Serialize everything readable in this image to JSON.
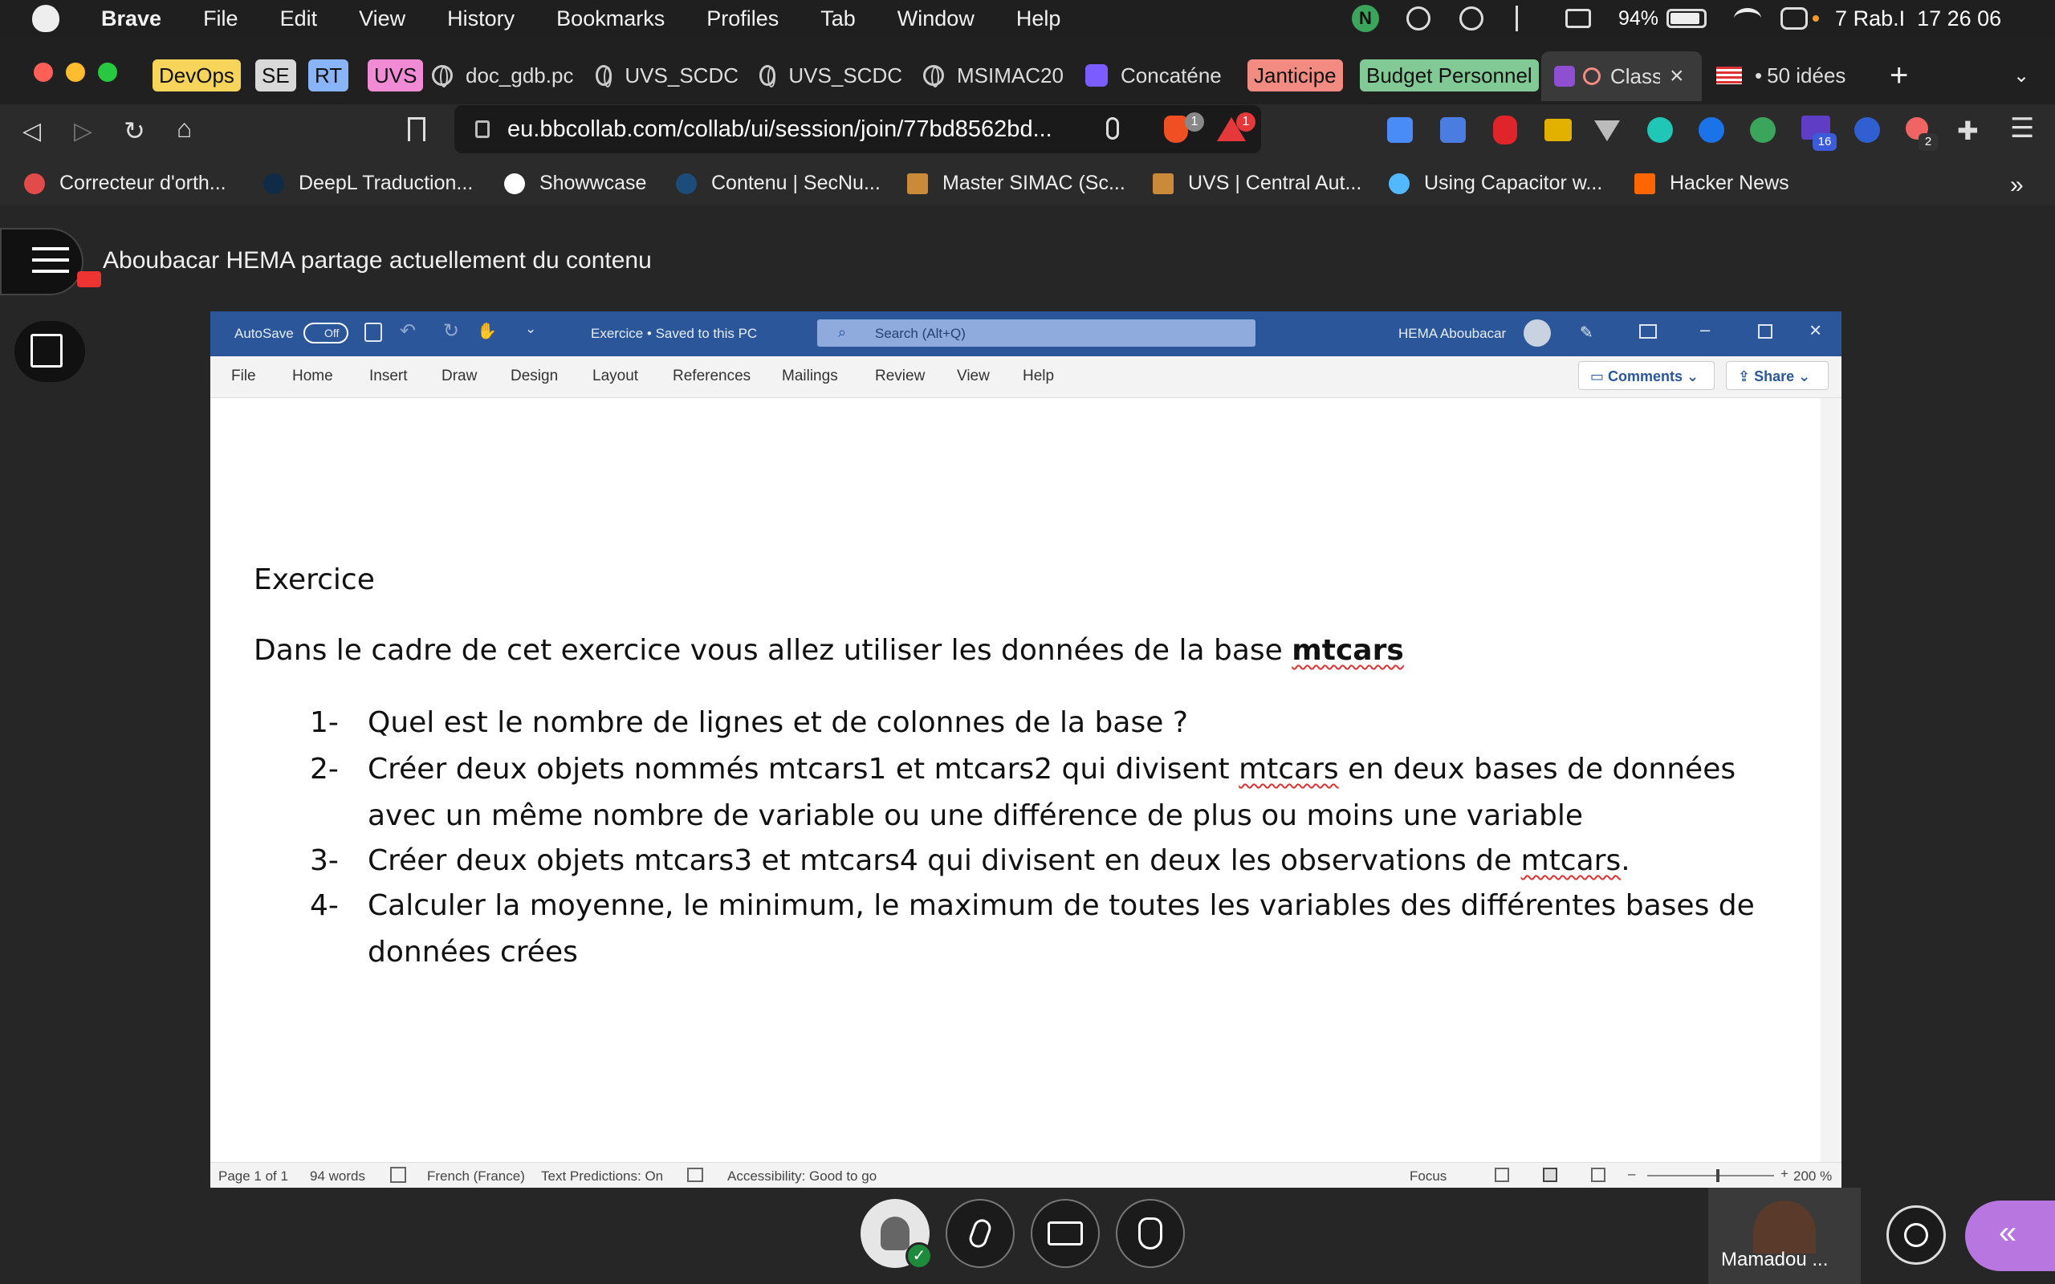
{
  "menubar": {
    "app": "Brave",
    "items": [
      "File",
      "Edit",
      "View",
      "History",
      "Bookmarks",
      "Profiles",
      "Tab",
      "Window",
      "Help"
    ],
    "battery": "94%",
    "datetime": "7 Rab.I  17 26 06"
  },
  "tabs": {
    "groups": [
      {
        "label": "DevOps",
        "color": "#f7d45a"
      },
      {
        "label": "SE",
        "color": "#d9d9d9"
      },
      {
        "label": "RT",
        "color": "#8ab4f8"
      },
      {
        "label": "UVS",
        "color": "#f28bd6"
      }
    ],
    "items": [
      {
        "label": "doc_gdb.pc"
      },
      {
        "label": "UVS_SCDC"
      },
      {
        "label": "UVS_SCDC"
      },
      {
        "label": "MSIMAC20"
      },
      {
        "label": "Concaténe"
      }
    ],
    "group_janticipe": {
      "label": "Janticipe",
      "color": "#f28b82"
    },
    "group_budget": {
      "label": "Budget Personnel",
      "color": "#81c995"
    },
    "active": {
      "label": "Class"
    },
    "last": {
      "label": "50 idées"
    }
  },
  "nav": {
    "url": "eu.bbcollab.com/collab/ui/session/join/77bd8562bd...",
    "brave_badge": "1",
    "rewards_badge": "1",
    "ext_badge_16": "16",
    "ext_badge_2": "2"
  },
  "bookmarks": [
    {
      "label": "Correcteur d'orth...",
      "color": "#e34b4b"
    },
    {
      "label": "DeepL Traduction...",
      "color": "#0f2b46"
    },
    {
      "label": "Showwcase",
      "color": "#ffffff"
    },
    {
      "label": "Contenu | SecNu...",
      "color": "#1b4c7a"
    },
    {
      "label": "Master SIMAC (Sc...",
      "color": "#c98a3a"
    },
    {
      "label": "UVS | Central Aut...",
      "color": "#c98a3a"
    },
    {
      "label": "Using Capacitor w...",
      "color": "#53b9ff"
    },
    {
      "label": "Hacker News",
      "color": "#ff6600"
    }
  ],
  "collab": {
    "share_notice": "Aboubacar HEMA partage actuellement du contenu",
    "participant": "Mamadou ..."
  },
  "word": {
    "autosave": "AutoSave",
    "autosave_state": "Off",
    "doc_title": "Exercice • Saved to this PC",
    "search_placeholder": "Search (Alt+Q)",
    "user": "HEMA Aboubacar",
    "ribbon": [
      "File",
      "Home",
      "Insert",
      "Draw",
      "Design",
      "Layout",
      "References",
      "Mailings",
      "Review",
      "View",
      "Help"
    ],
    "comments": "Comments",
    "share": "Share",
    "status": {
      "page": "Page 1 of 1",
      "words": "94 words",
      "language": "French (France)",
      "predictions": "Text Predictions: On",
      "accessibility": "Accessibility: Good to go",
      "focus": "Focus",
      "zoom": "200 %"
    },
    "doc": {
      "heading": "Exercice",
      "intro": "Dans le cadre de cet exercice vous allez utiliser les données de la base ",
      "intro_bold": "mtcars",
      "q1_num": "1-",
      "q1": "Quel est le nombre de lignes et de colonnes de la base ?",
      "q2_num": "2-",
      "q2a_pre": "Créer deux objets nommés mtcars1 et mtcars2 qui divisent ",
      "q2a_word": "mtcars",
      "q2a_post": " en deux bases de données",
      "q2b": "avec un même nombre de variable ou une différence de plus ou moins une variable",
      "q3_num": "3-",
      "q3_pre": "Créer deux objets mtcars3 et mtcars4 qui divisent en deux les observations de ",
      "q3_word": "mtcars",
      "q3_post": ".",
      "q4_num": "4-",
      "q4a": "Calculer la moyenne, le minimum, le maximum de toutes les variables des différentes bases de",
      "q4b": "données crées"
    }
  }
}
